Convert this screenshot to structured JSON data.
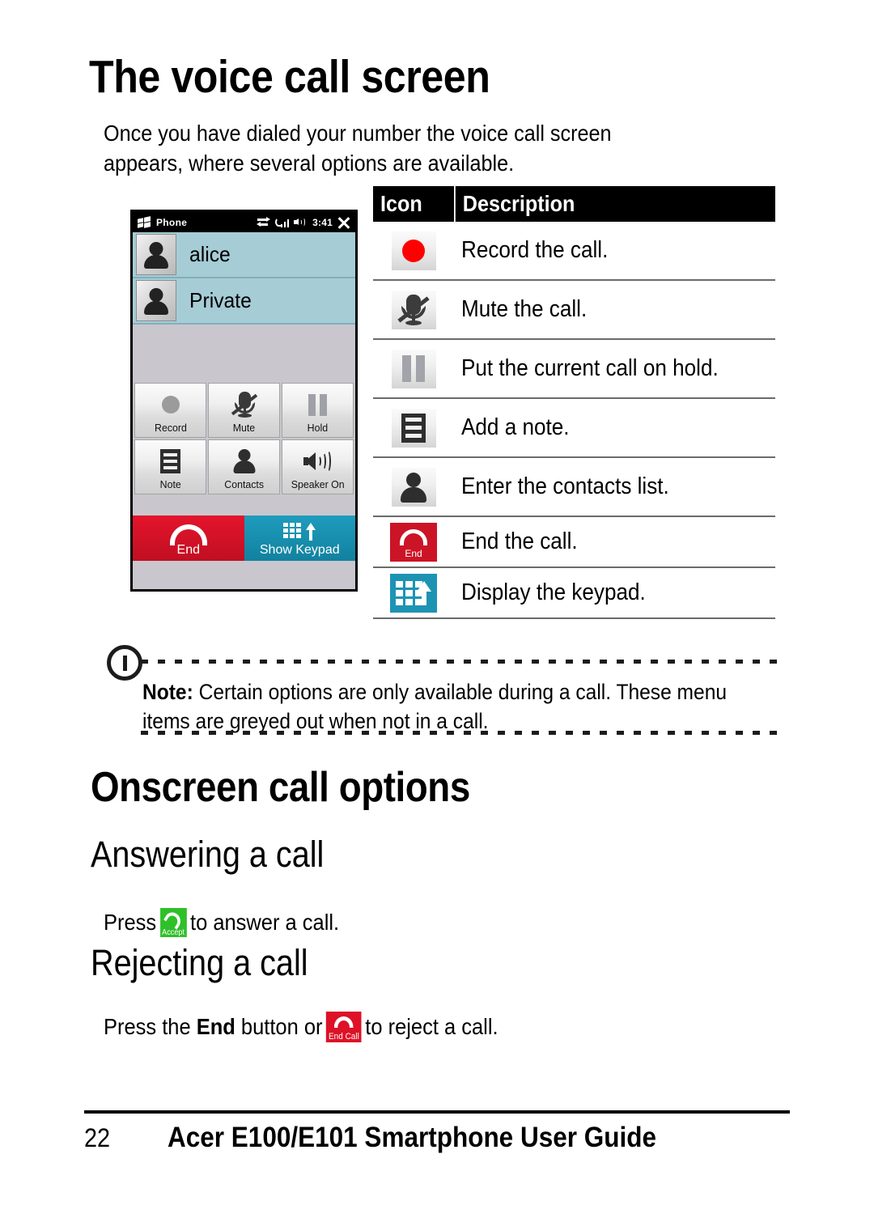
{
  "page": {
    "title": "The voice call screen",
    "intro_line1": "Once you have dialed your number the voice call screen",
    "intro_line2": "appears, where several options are available."
  },
  "phone_screenshot": {
    "titlebar": {
      "app_name": "Phone",
      "time": "3:41",
      "icons": [
        "windows-start-icon",
        "sync-icon",
        "signal-icon",
        "speaker-icon",
        "close-icon"
      ]
    },
    "callers": [
      {
        "name": "alice"
      },
      {
        "name": "Private"
      }
    ],
    "buttons": [
      {
        "label": "Record",
        "icon": "record-icon"
      },
      {
        "label": "Mute",
        "icon": "mute-icon"
      },
      {
        "label": "Hold",
        "icon": "hold-icon"
      },
      {
        "label": "Note",
        "icon": "note-icon"
      },
      {
        "label": "Contacts",
        "icon": "contacts-icon"
      },
      {
        "label": "Speaker On",
        "icon": "speaker-icon"
      }
    ],
    "softkeys": {
      "left": {
        "label": "End",
        "icon": "hangup-icon",
        "color": "#cc1427"
      },
      "right": {
        "label": "Show Keypad",
        "icon": "keypad-icon",
        "color": "#1d93b4"
      }
    }
  },
  "icon_table": {
    "headers": {
      "icon": "Icon",
      "description": "Description"
    },
    "rows": [
      {
        "icon": "record-icon",
        "description": "Record the call."
      },
      {
        "icon": "mute-icon",
        "description": "Mute the call."
      },
      {
        "icon": "hold-icon",
        "description": "Put the current call on hold."
      },
      {
        "icon": "note-icon",
        "description": "Add a note."
      },
      {
        "icon": "contacts-icon",
        "description": "Enter the contacts list."
      },
      {
        "icon": "end-call-icon",
        "description": "End the call."
      },
      {
        "icon": "keypad-icon",
        "description": "Display the keypad."
      }
    ]
  },
  "note": {
    "icon": "exclamation-icon",
    "label": "Note:",
    "text": " Certain options are only available during a call. These menu items are greyed out when not in a call."
  },
  "sections": {
    "onscreen_call_options": "Onscreen call options",
    "answering_a_call": "Answering a call",
    "rejecting_a_call": "Rejecting a call"
  },
  "answering": {
    "prefix": "Press",
    "icon_label": "Accept",
    "suffix": "to answer a call."
  },
  "rejecting": {
    "prefix": "Press the",
    "bold": "End",
    "middle": "button or",
    "icon_label": "End Call",
    "suffix": "to reject a call."
  },
  "footer": {
    "page_number": "22",
    "title": "Acer E100/E101 Smartphone User Guide"
  },
  "colors": {
    "accent_red": "#cc1427",
    "accent_teal": "#1d93b4",
    "accent_green": "#2fc029",
    "caller_bg": "#a6ccd6",
    "record_red": "#ff0000"
  }
}
